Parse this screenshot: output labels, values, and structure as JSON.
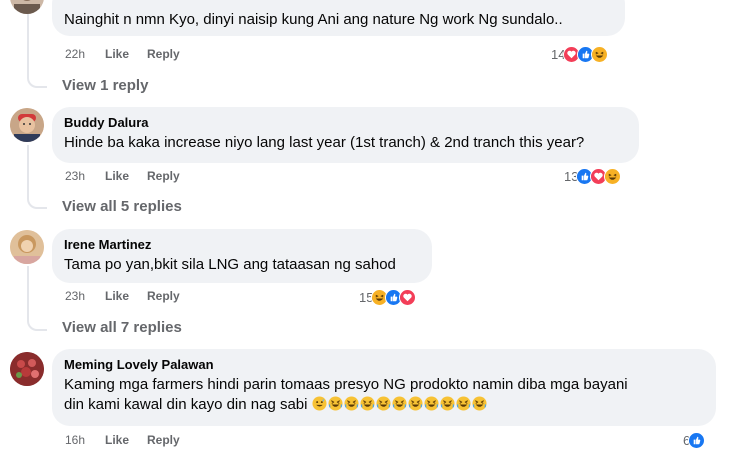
{
  "comments": [
    {
      "author": "",
      "text": "Nainghit n nmn Kyo, dinyi naisip kung Ani ang nature Ng work Ng sundalo..",
      "time": "22h",
      "like_label": "Like",
      "reply_label": "Reply",
      "reaction_count": "14",
      "reactions": [
        "love",
        "like",
        "haha"
      ],
      "view_replies": "View 1 reply"
    },
    {
      "author": "Buddy Dalura",
      "text": "Hinde ba kaka increase niyo lang last year (1st tranch) & 2nd tranch this year?",
      "time": "23h",
      "like_label": "Like",
      "reply_label": "Reply",
      "reaction_count": "13",
      "reactions": [
        "like",
        "love",
        "haha"
      ],
      "view_replies": "View all 5 replies"
    },
    {
      "author": "Irene Martinez",
      "text": "Tama po yan,bkit sila LNG ang tataasan ng sahod",
      "time": "23h",
      "like_label": "Like",
      "reply_label": "Reply",
      "reaction_count": "15",
      "reactions": [
        "haha",
        "like",
        "love"
      ],
      "view_replies": "View all 7 replies"
    },
    {
      "author": "Meming Lovely Palawan",
      "text_line1": "Kaming mga farmers hindi parin tomaas presyo NG prodokto namin diba mga bayani",
      "text_line2": "din kami kawal din kayo din nag sabi",
      "time": "16h",
      "like_label": "Like",
      "reply_label": "Reply",
      "reaction_count": "6",
      "reactions": [
        "like"
      ]
    }
  ],
  "colors": {
    "bubble": "#f0f2f5",
    "meta": "#65676b",
    "like_blue": "#1877f2",
    "love_red": "#f33e58",
    "haha_yellow": "#f7b125"
  }
}
